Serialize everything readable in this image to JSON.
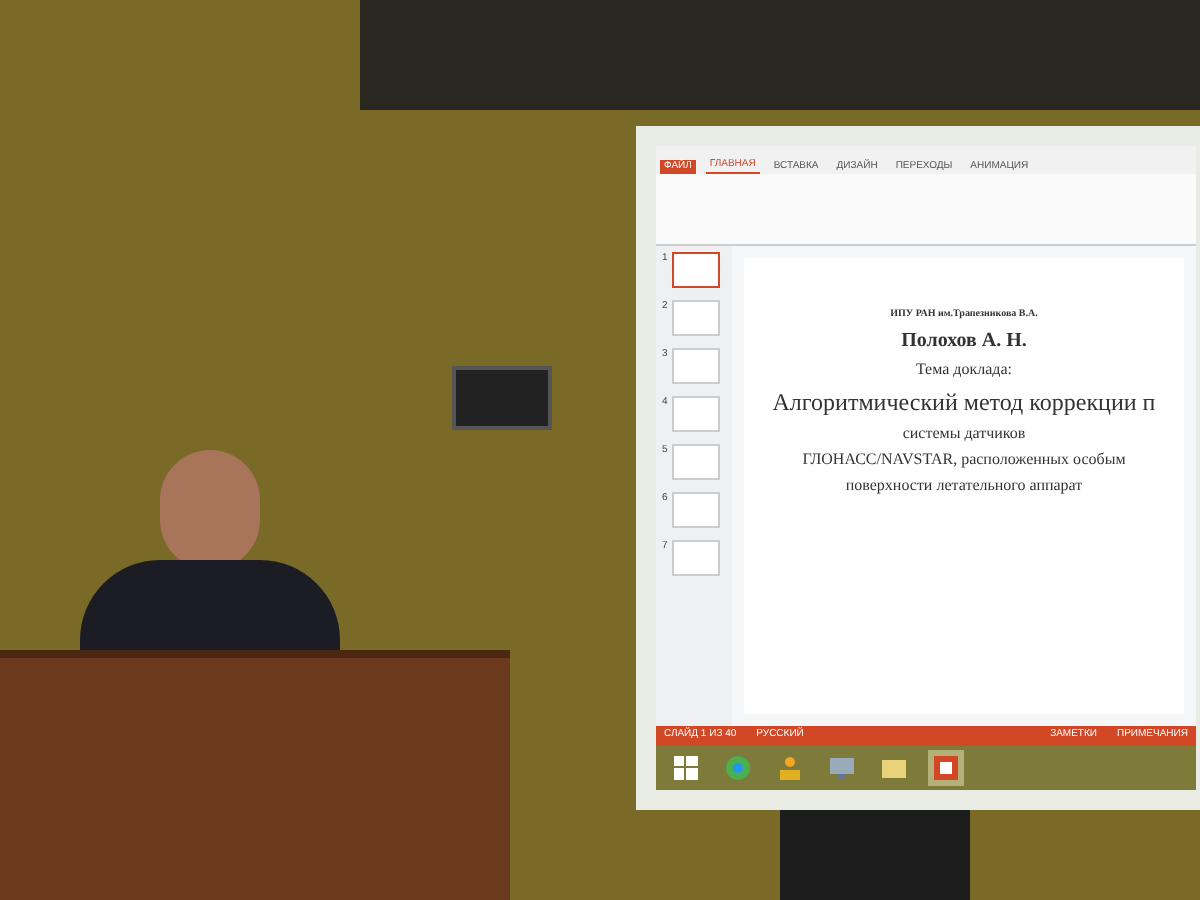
{
  "window": {
    "tabs": [
      {
        "label": "ФАЙЛ",
        "kind": "file",
        "selected": false
      },
      {
        "label": "ГЛАВНАЯ",
        "kind": "tab",
        "selected": true
      },
      {
        "label": "ВСТАВКА",
        "kind": "tab",
        "selected": false
      },
      {
        "label": "ДИЗАЙН",
        "kind": "tab",
        "selected": false
      },
      {
        "label": "ПЕРЕХОДЫ",
        "kind": "tab",
        "selected": false
      },
      {
        "label": "АНИМАЦИЯ",
        "kind": "tab",
        "selected": false
      }
    ]
  },
  "thumbnails": [
    {
      "number": "1",
      "selected": true
    },
    {
      "number": "2",
      "selected": false
    },
    {
      "number": "3",
      "selected": false
    },
    {
      "number": "4",
      "selected": false
    },
    {
      "number": "5",
      "selected": false
    },
    {
      "number": "6",
      "selected": false
    },
    {
      "number": "7",
      "selected": false
    }
  ],
  "slide": {
    "lines": [
      {
        "text": "ИПУ РАН им.Трапезникова В.А.",
        "kind": "small"
      },
      {
        "text": "Полохов А. Н.",
        "kind": "bold"
      },
      {
        "text": "Тема доклада:",
        "kind": "normal"
      },
      {
        "text": "Алгоритмический метод коррекции п",
        "kind": "large"
      },
      {
        "text": "системы датчиков",
        "kind": "normal"
      },
      {
        "text": "ГЛОНАСС/NAVSTAR, расположенных особым",
        "kind": "normal"
      },
      {
        "text": "поверхности летательного аппарат",
        "kind": "normal"
      }
    ]
  },
  "status_bar": {
    "left": [
      "СЛАЙД 1 ИЗ 40",
      "РУССКИЙ"
    ],
    "right": [
      "ЗАМЕТКИ",
      "ПРИМЕЧАНИЯ"
    ]
  },
  "taskbar": [
    {
      "kind": "windows",
      "selected": false
    },
    {
      "kind": "browser",
      "selected": false
    },
    {
      "kind": "person",
      "selected": false
    },
    {
      "kind": "monitor",
      "selected": false
    },
    {
      "kind": "folder",
      "selected": false
    },
    {
      "kind": "slides",
      "selected": true
    }
  ]
}
